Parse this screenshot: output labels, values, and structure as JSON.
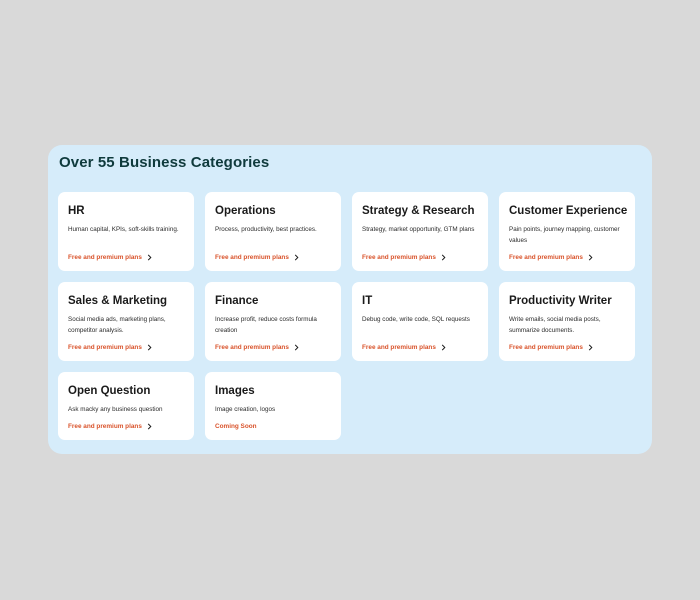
{
  "panel": {
    "title": "Over 55 Business Categories"
  },
  "cards": [
    {
      "title": "HR",
      "desc": "Human capital, KPIs, soft-skills training.",
      "link": "Free and premium plans",
      "has_chevron": true
    },
    {
      "title": "Operations",
      "desc": "Process, productivity, best practices.",
      "link": "Free and premium plans",
      "has_chevron": true
    },
    {
      "title": "Strategy & Research",
      "desc": "Strategy, market opportunity, GTM plans",
      "link": "Free and premium plans",
      "has_chevron": true
    },
    {
      "title": "Customer Experience",
      "desc": "Pain points, journey mapping, customer values",
      "link": "Free and premium plans",
      "has_chevron": true
    },
    {
      "title": "Sales & Marketing",
      "desc": "Social media ads, marketing plans, competitor analysis.",
      "link": "Free and premium plans",
      "has_chevron": true
    },
    {
      "title": "Finance",
      "desc": "Increase profit, reduce costs formula creation",
      "link": "Free and premium plans",
      "has_chevron": true
    },
    {
      "title": "IT",
      "desc": "Debug code, write code, SQL requests",
      "link": "Free and premium plans",
      "has_chevron": true
    },
    {
      "title": "Productivity Writer",
      "desc": "Write emails, social media posts, summarize documents.",
      "link": "Free and premium plans",
      "has_chevron": true
    },
    {
      "title": "Open Question",
      "desc": "Ask macky any business question",
      "link": "Free and premium plans",
      "has_chevron": true
    },
    {
      "title": "Images",
      "desc": "Image creation, logos",
      "link": "Coming Soon",
      "has_chevron": false
    }
  ],
  "colors": {
    "page_background": "#d9d9d9",
    "panel_background": "#d6ecfa",
    "title_color": "#0f3a3c",
    "link_color": "#d9532b"
  },
  "icons": {
    "card_link": "chevron-right-icon"
  }
}
